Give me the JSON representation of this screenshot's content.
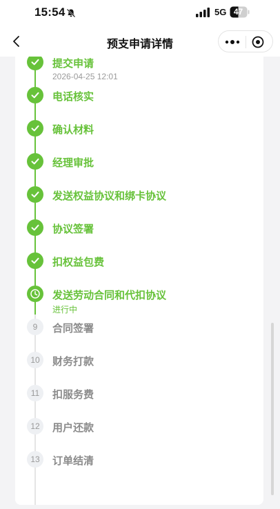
{
  "status_bar": {
    "time": "15:54",
    "network": "5G",
    "battery": "47"
  },
  "nav": {
    "title": "预支申请详情"
  },
  "colors": {
    "done": "#67c23a",
    "todo": "#8b8b8b",
    "todo_node_bg": "#eef0f3"
  },
  "steps": [
    {
      "title": "提交申请",
      "state": "done",
      "sub": "2026-04-25 12:01",
      "icon": "check-icon"
    },
    {
      "title": "电话核实",
      "state": "done",
      "icon": "check-icon"
    },
    {
      "title": "确认材料",
      "state": "done",
      "icon": "check-icon"
    },
    {
      "title": "经理审批",
      "state": "done",
      "icon": "check-icon"
    },
    {
      "title": "发送权益协议和绑卡协议",
      "state": "done",
      "icon": "check-icon"
    },
    {
      "title": "协议签署",
      "state": "done",
      "icon": "check-icon"
    },
    {
      "title": "扣权益包费",
      "state": "done",
      "icon": "check-icon"
    },
    {
      "title": "发送劳动合同和代扣协议",
      "state": "active",
      "sub": "进行中",
      "icon": "clock-icon"
    },
    {
      "title": "合同签署",
      "state": "todo",
      "number": "9"
    },
    {
      "title": "财务打款",
      "state": "todo",
      "number": "10"
    },
    {
      "title": "扣服务费",
      "state": "todo",
      "number": "11"
    },
    {
      "title": "用户还款",
      "state": "todo",
      "number": "12"
    },
    {
      "title": "订单结清",
      "state": "todo",
      "number": "13"
    }
  ]
}
